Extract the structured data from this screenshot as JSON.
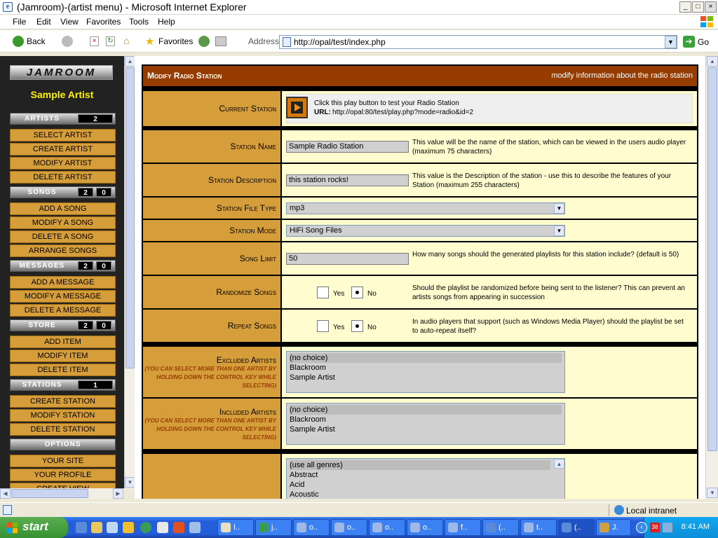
{
  "window": {
    "title": "(Jamroom)-(artist menu) - Microsoft Internet Explorer",
    "minimize": "_",
    "maximize": "□",
    "close": "×"
  },
  "menu": [
    "File",
    "Edit",
    "View",
    "Favorites",
    "Tools",
    "Help"
  ],
  "toolbar": {
    "back": "Back",
    "favorites": "Favorites",
    "address_label": "Address",
    "url": "http://opal/test/index.php",
    "go": "Go"
  },
  "sidebar": {
    "logo": "JAMROOM",
    "artist": "Sample Artist",
    "sections": {
      "artists": {
        "label": "ARTISTS",
        "count": "2"
      },
      "songs": {
        "label": "SONGS",
        "count1": "2",
        "count2": "0"
      },
      "messages": {
        "label": "MESSAGES",
        "count1": "2",
        "count2": "0"
      },
      "store": {
        "label": "STORE",
        "count1": "2",
        "count2": "0"
      },
      "stations": {
        "label": "STATIONS",
        "count": "1"
      },
      "options": {
        "label": "OPTIONS"
      }
    },
    "items": {
      "select_artist": "SELECT ARTIST",
      "create_artist": "CREATE ARTIST",
      "modify_artist": "MODIFY ARTIST",
      "delete_artist": "DELETE ARTIST",
      "add_song": "ADD A SONG",
      "modify_song": "MODIFY A SONG",
      "delete_song": "DELETE A SONG",
      "arrange_songs": "ARRANGE SONGS",
      "add_message": "ADD A MESSAGE",
      "modify_message": "MODIFY A MESSAGE",
      "delete_message": "DELETE A MESSAGE",
      "add_item": "ADD ITEM",
      "modify_item": "MODIFY ITEM",
      "delete_item": "DELETE ITEM",
      "create_station": "CREATE STATION",
      "modify_station": "MODIFY STATION",
      "delete_station": "DELETE STATION",
      "your_site": "YOUR SITE",
      "your_profile": "YOUR PROFILE",
      "partial": "CREATE VIEW"
    }
  },
  "form": {
    "title": "Modify Radio Station",
    "description": "modify information about the radio station",
    "current_station": {
      "label": "Current Station",
      "play_text": "Click this play button to test your Radio Station",
      "url_label": "URL:",
      "url": "http://opal:80/test/play.php?mode=radio&id=2"
    },
    "station_name": {
      "label": "Station Name",
      "value": "Sample Radio Station",
      "help": "This value will be the name of the station, which can be viewed in the users audio player (maximum 75 characters)"
    },
    "station_description": {
      "label": "Station Description",
      "value": "this station rocks!",
      "help": "This value is the Description of the station - use this to describe the features of your Station (maximum 255 characters)"
    },
    "station_file_type": {
      "label": "Station File Type",
      "value": "mp3"
    },
    "station_mode": {
      "label": "Station Mode",
      "value": "HiFi Song Files"
    },
    "song_limit": {
      "label": "Song Limit",
      "value": "50",
      "help": "How many songs should the generated playlists for this station include? (default is 50)"
    },
    "randomize": {
      "label": "Randomize Songs",
      "yes": "Yes",
      "no": "No",
      "selected": "No",
      "help": "Should the playlist be randomized before being sent to the listener? This can prevent an artists songs from appearing in succession"
    },
    "repeat": {
      "label": "Repeat Songs",
      "yes": "Yes",
      "no": "No",
      "selected": "No",
      "help": "In audio players that support (such as Windows Media Player) should the playlist be set to auto-repeat itself?"
    },
    "excluded": {
      "label": "Excluded Artists",
      "sub": "(you can select more than one artist by holding down the control key while selecting)",
      "options": [
        "(no choice)",
        "Blackroom",
        "Sample Artist"
      ]
    },
    "included": {
      "label": "Included Artists",
      "sub": "(you can select more than one artist by holding down the control key while selecting)",
      "options": [
        "(no choice)",
        "Blackroom",
        "Sample Artist"
      ]
    },
    "genres": {
      "options": [
        "(use all genres)",
        "Abstract",
        "Acid",
        "Acoustic"
      ]
    }
  },
  "status": {
    "zone": "Local intranet"
  },
  "taskbar": {
    "start": "start",
    "buttons": [
      "I..",
      "j..",
      "o..",
      "o..",
      "o..",
      "o..",
      "f..",
      "(..",
      "t..",
      "(..",
      "J."
    ],
    "clock": "8:41 AM"
  }
}
